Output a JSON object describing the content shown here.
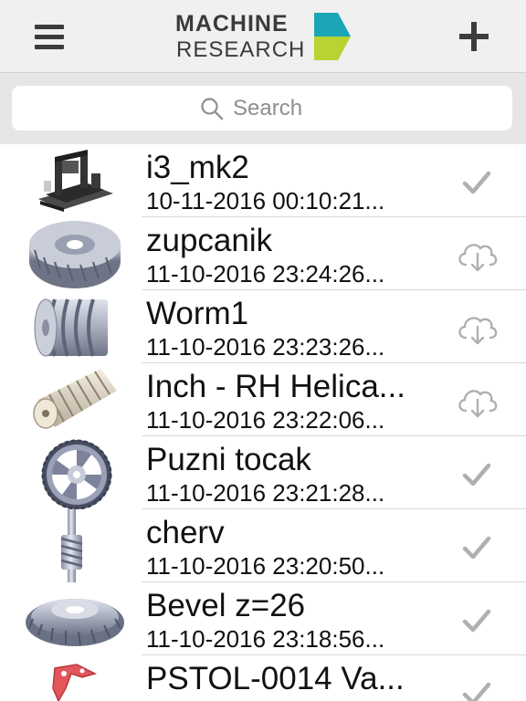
{
  "header": {
    "logo_line1": "MACHINE",
    "logo_line2": "RESEARCH",
    "menu_icon": "hamburger-menu-icon",
    "add_icon": "plus-icon"
  },
  "search": {
    "placeholder": "Search",
    "value": ""
  },
  "colors": {
    "logo_teal": "#1aa6b7",
    "logo_green": "#b8d432",
    "icon_gray": "#3c3c3c",
    "status_gray": "#b0b0b0"
  },
  "items": [
    {
      "title": "i3_mk2",
      "date": "10-11-2016 00:10:21...",
      "status": "downloaded"
    },
    {
      "title": "zupcanik",
      "date": "11-10-2016 23:24:26...",
      "status": "cloud"
    },
    {
      "title": "Worm1",
      "date": "11-10-2016 23:23:26...",
      "status": "cloud"
    },
    {
      "title": "Inch - RH Helica...",
      "date": "11-10-2016 23:22:06...",
      "status": "cloud"
    },
    {
      "title": "Puzni tocak",
      "date": "11-10-2016 23:21:28...",
      "status": "downloaded"
    },
    {
      "title": "cherv",
      "date": "11-10-2016 23:20:50...",
      "status": "downloaded"
    },
    {
      "title": "Bevel z=26",
      "date": "11-10-2016 23:18:56...",
      "status": "downloaded"
    },
    {
      "title": "PSTOL-0014 Va...",
      "date": "",
      "status": "downloaded"
    }
  ]
}
